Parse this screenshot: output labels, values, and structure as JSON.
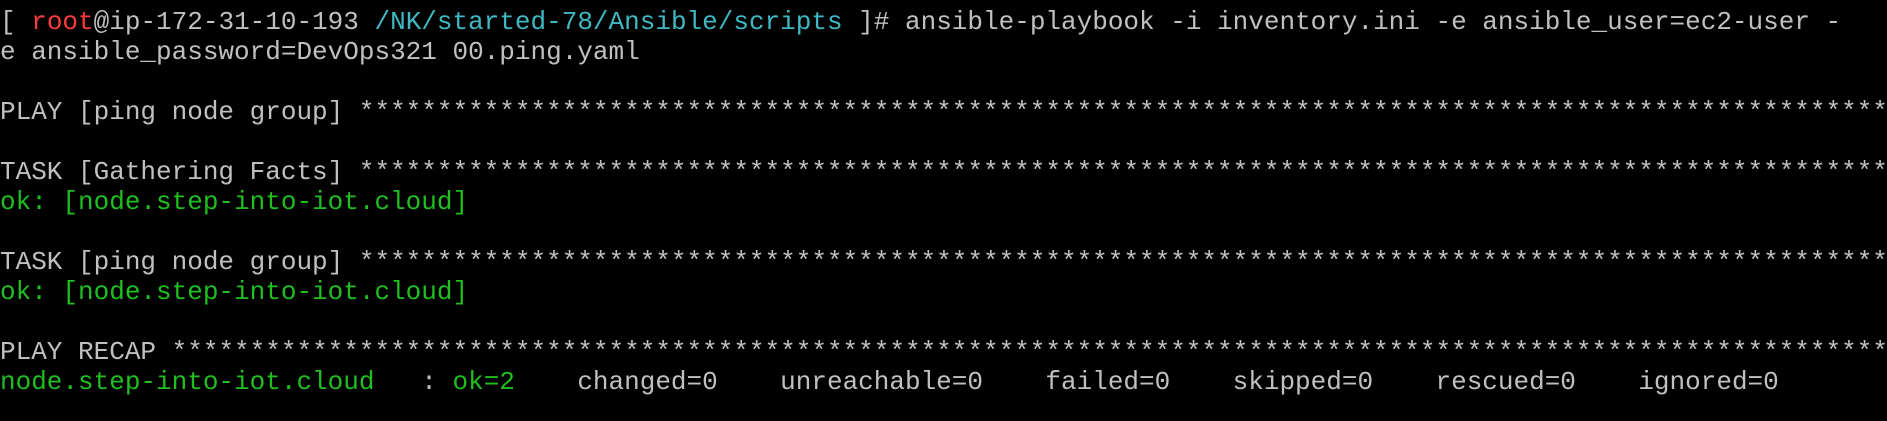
{
  "prompt": {
    "open_bracket": "[ ",
    "user": "root",
    "at": "@",
    "host": "ip-172-31-10-193",
    "space": " ",
    "cwd": "/NK/started-78/Ansible/scripts",
    "close": " ]# ",
    "command_line1": "ansible-playbook -i inventory.ini -e ansible_user=ec2-user -",
    "command_line2": "e ansible_password=DevOps321 00.ping.yaml"
  },
  "play": {
    "label": "PLAY [ping node group] ",
    "stars": "********************************************************************************************************************************"
  },
  "tasks": [
    {
      "label": "TASK [Gathering Facts] ",
      "stars": "*******************************************************************************************************************************",
      "result": "ok: [node.step-into-iot.cloud]"
    },
    {
      "label": "TASK [ping node group] ",
      "stars": "*******************************************************************************************************************************",
      "result": "ok: [node.step-into-iot.cloud]"
    }
  ],
  "recap": {
    "label": "PLAY RECAP ",
    "stars": "******************************************************************************************************************************************",
    "host": "node.step-into-iot.cloud",
    "sep": "   : ",
    "ok": "ok=2",
    "changed": "    changed=0",
    "unreachable": "    unreachable=0",
    "failed": "    failed=0",
    "skipped": "    skipped=0",
    "rescued": "    rescued=0",
    "ignored": "    ignored=0"
  },
  "colors": {
    "background": "#000000",
    "text": "#c0c0c0",
    "user": "#ff3b3b",
    "path": "#3fb8c4",
    "ok": "#1fbf1f"
  }
}
